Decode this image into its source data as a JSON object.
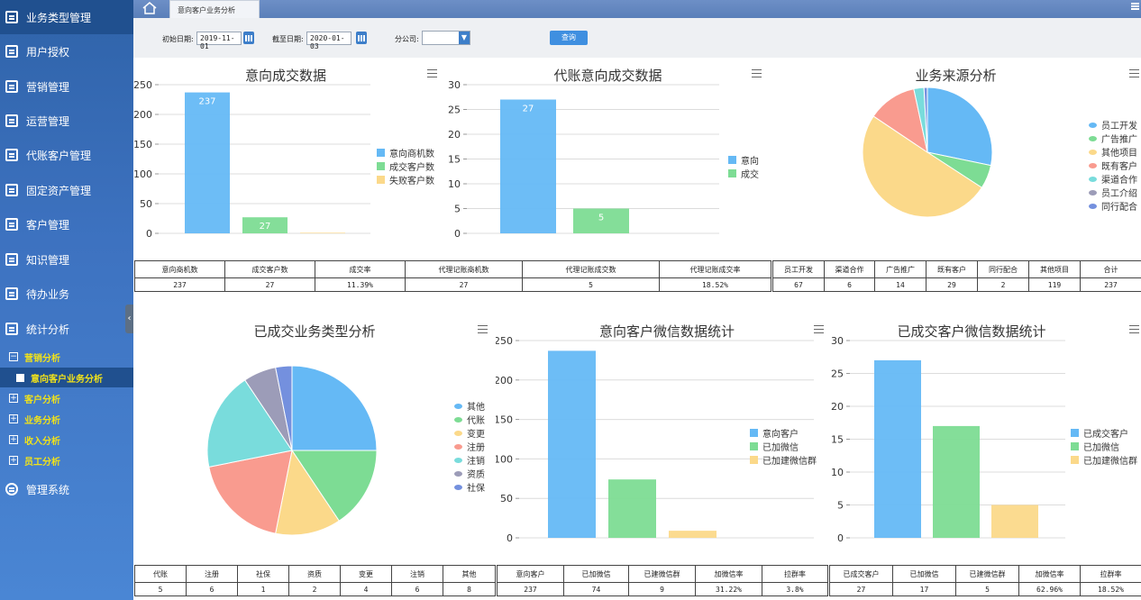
{
  "sidebar": {
    "items": [
      {
        "label": "业务类型管理",
        "icon": "list-icon"
      },
      {
        "label": "用户授权",
        "icon": "save-icon"
      },
      {
        "label": "营销管理",
        "icon": "list-icon"
      },
      {
        "label": "运营管理",
        "icon": "edit-icon"
      },
      {
        "label": "代账客户管理",
        "icon": "grid-icon"
      },
      {
        "label": "固定资产管理",
        "icon": "list-icon"
      },
      {
        "label": "客户管理",
        "icon": "list-icon"
      },
      {
        "label": "知识管理",
        "icon": "list-icon"
      },
      {
        "label": "待办业务",
        "icon": "list-icon"
      },
      {
        "label": "统计分析",
        "icon": "chart-icon"
      }
    ],
    "sub": [
      {
        "label": "营销分析",
        "sign": "−"
      },
      {
        "label": "意向客户业务分析",
        "sign": ""
      },
      {
        "label": "客户分析",
        "sign": "+"
      },
      {
        "label": "业务分析",
        "sign": "+"
      },
      {
        "label": "收入分析",
        "sign": "+"
      },
      {
        "label": "员工分析",
        "sign": "+"
      }
    ],
    "system": {
      "label": "管理系统",
      "icon": "gear-icon"
    },
    "collapse_glyph": "‹"
  },
  "topbar": {
    "tab_label": "意向客户业务分析"
  },
  "filters": {
    "start_label": "初始日期:",
    "start_value": "2019-11-01",
    "end_label": "截至日期:",
    "end_value": "2020-01-03",
    "branch_label": "分公司:",
    "branch_value": "",
    "query_label": "查询"
  },
  "colors": {
    "blue": "#65b9f5",
    "green": "#7ddc94",
    "yellow": "#fbd98a",
    "pink": "#f99b8f",
    "teal": "#79dcdc",
    "gray": "#9c9cb8",
    "indigo": "#7490de"
  },
  "chart_data": [
    {
      "type": "bar",
      "title": "意向成交数据",
      "categories": [
        "意向商机数",
        "成交客户数",
        "失败客户数"
      ],
      "values": [
        237,
        27,
        1
      ],
      "data_labels": [
        "237",
        "27",
        ""
      ],
      "ylim": [
        0,
        250
      ],
      "yticks": [
        0,
        50,
        100,
        150,
        200,
        250
      ],
      "legend": "right",
      "grid": true
    },
    {
      "type": "bar",
      "title": "代账意向成交数据",
      "categories": [
        "意向",
        "成交"
      ],
      "values": [
        27,
        5
      ],
      "data_labels": [
        "27",
        "5"
      ],
      "ylim": [
        0,
        30
      ],
      "yticks": [
        0,
        5,
        10,
        15,
        20,
        25,
        30
      ],
      "legend": "right",
      "grid": true
    },
    {
      "type": "pie",
      "title": "业务来源分析",
      "labels": [
        "员工开发",
        "广告推广",
        "其他项目",
        "既有客户",
        "渠道合作",
        "员工介绍",
        "同行配合"
      ],
      "values": [
        67,
        14,
        119,
        29,
        6,
        0,
        2
      ],
      "legend": "right"
    },
    {
      "type": "pie",
      "title": "已成交业务类型分析",
      "labels": [
        "其他",
        "代账",
        "变更",
        "注册",
        "注销",
        "资质",
        "社保"
      ],
      "values": [
        8,
        5,
        4,
        6,
        6,
        2,
        1
      ],
      "legend": "right"
    },
    {
      "type": "bar",
      "title": "意向客户微信数据统计",
      "categories": [
        "意向客户",
        "已加微信",
        "已加建微信群"
      ],
      "values": [
        237,
        74,
        9
      ],
      "ylim": [
        0,
        250
      ],
      "yticks": [
        0,
        50,
        100,
        150,
        200,
        250
      ],
      "legend": "right",
      "grid": true
    },
    {
      "type": "bar",
      "title": "已成交客户微信数据统计",
      "categories": [
        "已成交客户",
        "已加微信",
        "已加建微信群"
      ],
      "values": [
        27,
        17,
        5
      ],
      "ylim": [
        0,
        30
      ],
      "yticks": [
        0,
        5,
        10,
        15,
        20,
        25,
        30
      ],
      "legend": "right",
      "grid": true
    }
  ],
  "tables": [
    {
      "headers": [
        "意向商机数",
        "成交客户数",
        "成交率",
        "代理记账商机数",
        "代理记账成交数",
        "代理记账成交率"
      ],
      "values": [
        "237",
        "27",
        "11.39%",
        "27",
        "5",
        "18.52%"
      ]
    },
    {
      "headers": [
        "员工开发",
        "渠道合作",
        "广告推广",
        "既有客户",
        "同行配合",
        "其他项目",
        "合计"
      ],
      "values": [
        "67",
        "6",
        "14",
        "29",
        "2",
        "119",
        "237"
      ]
    },
    {
      "headers": [
        "代账",
        "注册",
        "社保",
        "资质",
        "变更",
        "注销",
        "其他"
      ],
      "values": [
        "5",
        "6",
        "1",
        "2",
        "4",
        "6",
        "8"
      ]
    },
    {
      "headers": [
        "意向客户",
        "已加微信",
        "已建微信群",
        "加微信率",
        "拉群率"
      ],
      "values": [
        "237",
        "74",
        "9",
        "31.22%",
        "3.8%"
      ]
    },
    {
      "headers": [
        "已成交客户",
        "已加微信",
        "已建微信群",
        "加微信率",
        "拉群率"
      ],
      "values": [
        "27",
        "17",
        "5",
        "62.96%",
        "18.52%"
      ]
    }
  ]
}
